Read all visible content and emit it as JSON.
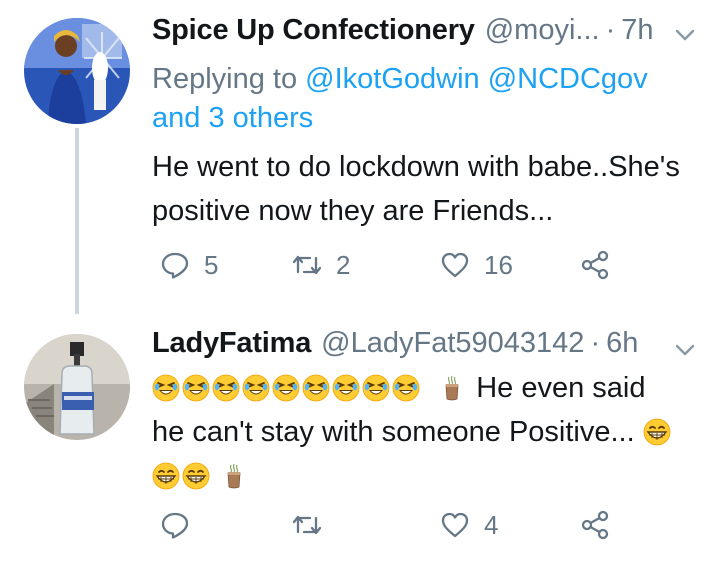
{
  "tweets": [
    {
      "name": "Spice Up Confectionery",
      "handle": "@moyi...",
      "separator": "·",
      "time": "7h",
      "replying_prefix": "Replying to",
      "replying_users": "@IkotGodwin @NCDCgov",
      "replying_others": "and 3 others",
      "text_line1": "He went to do lockdown with babe..She's",
      "text_line2": "positive now they are Friends...",
      "replies": "5",
      "retweets": "2",
      "likes": "16"
    },
    {
      "name": "LadyFatima",
      "handle": "@LadyFat59043142",
      "separator": "·",
      "time": "6h",
      "text_part1": "He even said",
      "text_part2": "he can't stay with someone Positive...",
      "replies": "",
      "retweets": "",
      "likes": "4"
    }
  ],
  "icons": {
    "reply": "reply-icon",
    "retweet": "retweet-icon",
    "like": "heart-icon",
    "share": "share-icon",
    "menu": "chevron-down-icon"
  },
  "colors": {
    "link": "#1da1f2",
    "secondary_text": "#657786",
    "primary_text": "#14171a",
    "thread_line": "#ccd6dd"
  }
}
